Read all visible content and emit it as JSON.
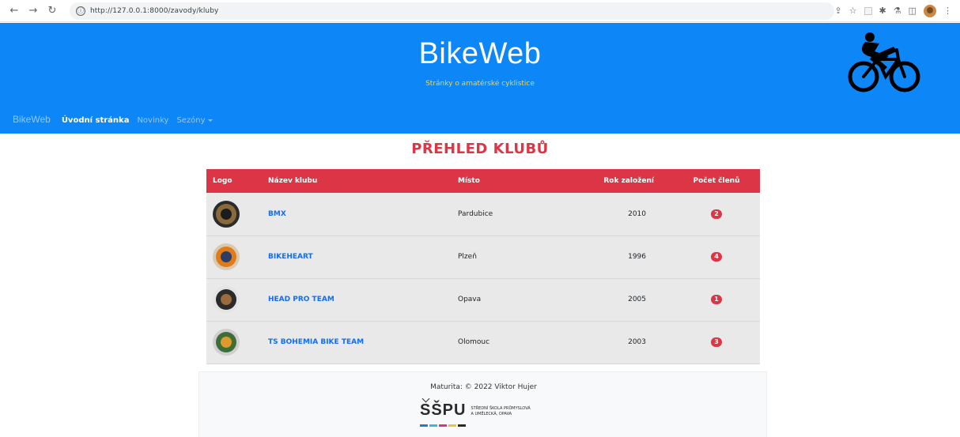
{
  "browser": {
    "url": "http://127.0.0.1:8000/zavody/kluby",
    "info_glyph": "ⓘ"
  },
  "header": {
    "title": "BikeWeb",
    "subtitle": "Stránky o amatérské cyklistice"
  },
  "nav": {
    "brand": "BikeWeb",
    "links": [
      {
        "label": "Úvodní stránka",
        "active": true
      },
      {
        "label": "Novinky",
        "active": false
      },
      {
        "label": "Sezóny",
        "active": false
      }
    ]
  },
  "page": {
    "title": "PŘEHLED KLUBŮ"
  },
  "table": {
    "headers": [
      "Logo",
      "Název klubu",
      "Místo",
      "Rok založení",
      "Počet členů"
    ],
    "rows": [
      {
        "name": "BMX",
        "place": "Pardubice",
        "year": "2010",
        "members": "2",
        "logo_colors": [
          "#2b2b2b",
          "#8a6a3a",
          "#1c1c1c"
        ]
      },
      {
        "name": "BIKEHEART",
        "place": "Plzeň",
        "year": "1996",
        "members": "4",
        "logo_colors": [
          "#d9c9b0",
          "#e07b1a",
          "#2c3e66"
        ]
      },
      {
        "name": "HEAD PRO TEAM",
        "place": "Opava",
        "year": "2005",
        "members": "1",
        "logo_colors": [
          "#e4e4e4",
          "#2b2b2b",
          "#9a6b3c"
        ]
      },
      {
        "name": "TS BOHEMIA BIKE TEAM",
        "place": "Olomouc",
        "year": "2003",
        "members": "3",
        "logo_colors": [
          "#cfcfcf",
          "#3f6d3a",
          "#e09a2c"
        ]
      }
    ]
  },
  "footer": {
    "text": "Maturita: © 2022 Viktor Hujer",
    "school_mark": "SŠPU",
    "school_line1": "STŘEDNÍ ŠKOLA PRŮMYSLOVÁ",
    "school_line2": "A UMĚLECKÁ, OPAVA"
  },
  "colors": {
    "header_bg": "#0d86f7",
    "accent_red": "#dc3545",
    "link_blue": "#0d6efd",
    "subtitle_yellow": "#ffd43b",
    "stripe_colors": [
      "#2a7bc0",
      "#3cb4e5",
      "#e0318b",
      "#f2c230",
      "#2a2a2a"
    ]
  },
  "icons": [
    "back-arrow-icon",
    "forward-arrow-icon",
    "reload-icon",
    "info-icon",
    "share-icon",
    "star-icon",
    "puzzle-icon",
    "flask-icon",
    "sidepanel-icon",
    "profile-avatar-icon",
    "kebab-menu-icon",
    "cyclist-logo-icon",
    "caret-down-icon"
  ]
}
